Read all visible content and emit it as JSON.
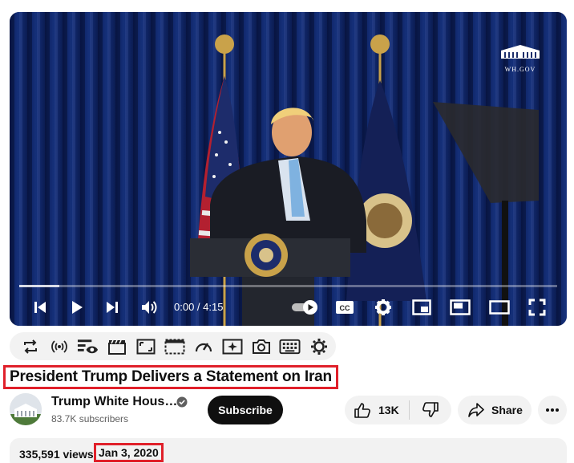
{
  "player": {
    "watermark": "WH.GOV",
    "time_display": "0:00 / 4:15",
    "progress_fraction": 0.075
  },
  "video": {
    "title": "President Trump Delivers a Statement on Iran",
    "views": "335,591 views",
    "date": "Jan 3, 2020"
  },
  "channel": {
    "name": "Trump White Hous…",
    "subscribers": "83.7K subscribers"
  },
  "actions": {
    "subscribe_label": "Subscribe",
    "like_count": "13K",
    "share_label": "Share"
  },
  "toolbar_icons": [
    "loop-icon",
    "broadcast-icon",
    "playlist-eye-icon",
    "clapper-icon",
    "crop-icon",
    "dashed-frame-icon",
    "speedometer-icon",
    "sparkle-icon",
    "camera-icon",
    "keyboard-icon",
    "gear-icon"
  ],
  "colors": {
    "highlight": "#e0202a",
    "subscribe_bg": "#0f0f0f",
    "pill_bg": "#f2f2f2",
    "curtain": "#12296e"
  }
}
